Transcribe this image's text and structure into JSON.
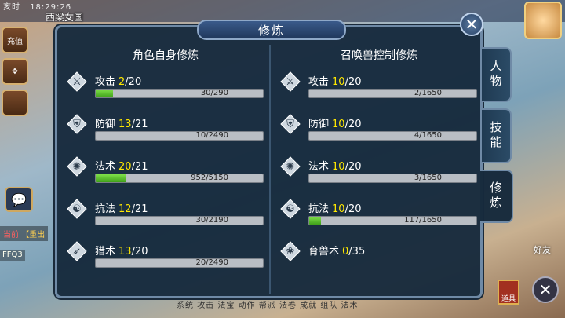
{
  "status": {
    "time_label": "亥时",
    "clock": "18:29:26"
  },
  "map_name": "西梁女国",
  "left": {
    "recharge": "充值",
    "chat_line1": "当前",
    "chat_line2": "【重出",
    "bottom_line": "FFQ3"
  },
  "bottom_menu": [
    "系统",
    "攻击",
    "法宝",
    "动作",
    "帮派",
    "法卷",
    "成就",
    "组队",
    "法术"
  ],
  "right": {
    "friend": "好友",
    "item": "道具"
  },
  "panel": {
    "title": "修炼",
    "left_header": "角色自身修炼",
    "right_header": "召唤兽控制修炼",
    "left_rows": [
      {
        "name": "攻击",
        "cur": "2",
        "max": "/20",
        "exp": "30/290",
        "progress": 0.103,
        "icon": "sword-icon"
      },
      {
        "name": "防御",
        "cur": "13",
        "max": "/21",
        "exp": "10/2490",
        "progress": 0.004,
        "icon": "shield-icon"
      },
      {
        "name": "法术",
        "cur": "20",
        "max": "/21",
        "exp": "952/5150",
        "progress": 0.185,
        "icon": "magic-icon"
      },
      {
        "name": "抗法",
        "cur": "12",
        "max": "/21",
        "exp": "30/2190",
        "progress": 0.014,
        "icon": "yinyang-icon"
      },
      {
        "name": "猎术",
        "cur": "13",
        "max": "/20",
        "exp": "20/2490",
        "progress": 0.008,
        "icon": "bow-icon"
      }
    ],
    "right_rows": [
      {
        "name": "攻击",
        "cur": "10",
        "max": "/20",
        "exp": "2/1650",
        "progress": 0.001,
        "icon": "sword-icon"
      },
      {
        "name": "防御",
        "cur": "10",
        "max": "/20",
        "exp": "4/1650",
        "progress": 0.002,
        "icon": "shield-icon"
      },
      {
        "name": "法术",
        "cur": "10",
        "max": "/20",
        "exp": "3/1650",
        "progress": 0.002,
        "icon": "magic-icon"
      },
      {
        "name": "抗法",
        "cur": "10",
        "max": "/20",
        "exp": "117/1650",
        "progress": 0.071,
        "icon": "yinyang-icon"
      },
      {
        "name": "育兽术",
        "cur": "0",
        "max": "/35",
        "icon": "pet-icon"
      }
    ],
    "tabs": [
      "人物",
      "技能",
      "修炼"
    ],
    "active_tab": "修炼"
  }
}
